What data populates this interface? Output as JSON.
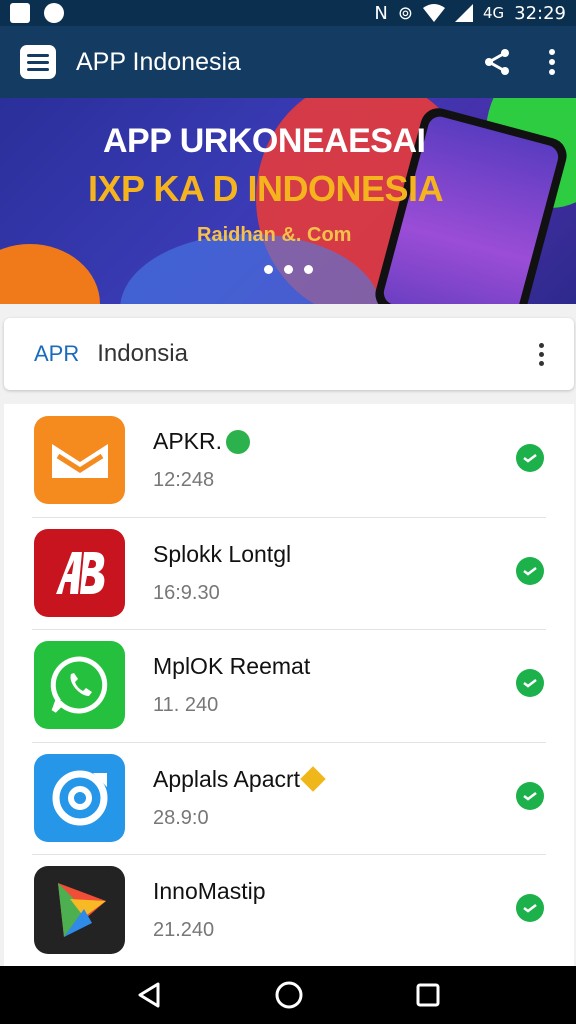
{
  "status_bar": {
    "time": "32:29",
    "network": "4G"
  },
  "app_bar": {
    "title": "APP Indonesia"
  },
  "banner": {
    "line1": "APP URKONEAESAI",
    "line2": "IXP KA D INDONESIA",
    "line3": "Raidhan &. Com"
  },
  "section": {
    "prefix": "APR",
    "name": "Indonsia"
  },
  "apps": [
    {
      "name": "APKR.",
      "meta": "12:248"
    },
    {
      "name": "Splokk Lontgl",
      "meta": "16:9.30"
    },
    {
      "name": "MplOK Reemat",
      "meta": "11. 240"
    },
    {
      "name": "Applals Apacrt",
      "meta": "28.9:0"
    },
    {
      "name": "InnoMastip",
      "meta": "21.240"
    }
  ],
  "colors": {
    "app_bar": "#143c63",
    "status_bar": "#0b2f4e",
    "check": "#1cb14a",
    "accent": "#1a6bbd"
  }
}
